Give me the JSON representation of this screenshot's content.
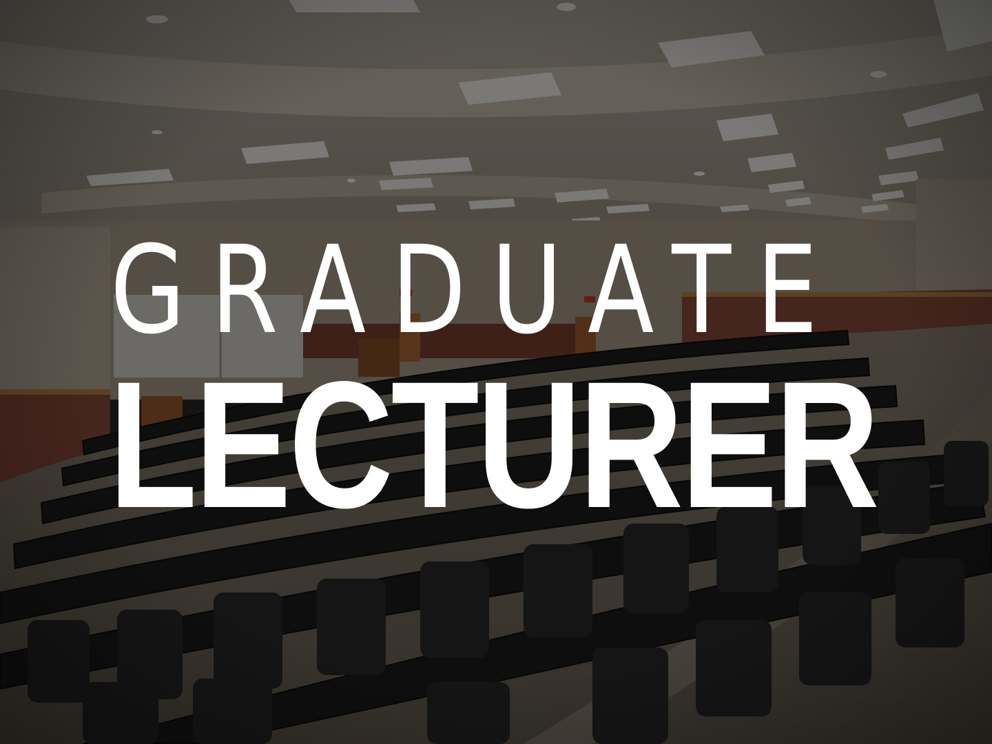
{
  "title": {
    "line1": "GRADUATE",
    "line2": "LECTURER"
  },
  "colors": {
    "text": "#ffffff",
    "overlay": "#000000",
    "wall": "#a9826b",
    "accent_wall": "#8a4a3b",
    "carpet": "#7d7364",
    "seat": "#1c1c1c",
    "ceiling": "#a49b8c"
  },
  "scene": {
    "subject": "lecture-hall",
    "overlay_opacity": 0.5
  }
}
